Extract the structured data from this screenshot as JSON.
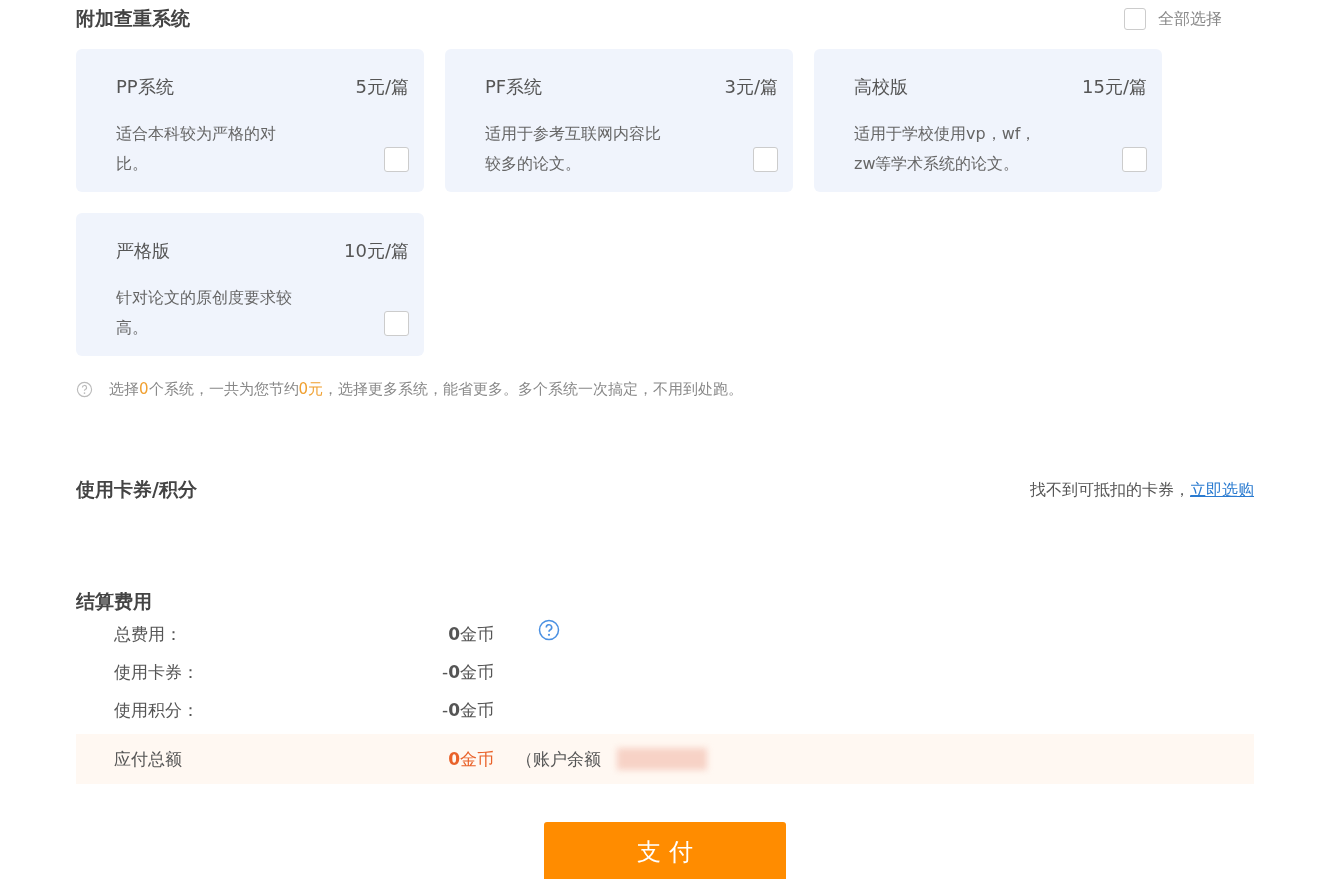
{
  "systems_section": {
    "title": "附加查重系统",
    "select_all": {
      "label": "全部选择",
      "checked": false
    },
    "cards": [
      {
        "name": "PP系统",
        "price": "5元/篇",
        "description": "适合本科较为严格的对比。",
        "checked": false
      },
      {
        "name": "PF系统",
        "price": "3元/篇",
        "description": "适用于参考互联网内容比较多的论文。",
        "checked": false
      },
      {
        "name": "高校版",
        "price": "15元/篇",
        "description": "适用于学校使用vp，wf，zw等学术系统的论文。",
        "checked": false
      },
      {
        "name": "严格版",
        "price": "10元/篇",
        "description": "针对论文的原创度要求较高。",
        "checked": false
      }
    ],
    "hint": [
      {
        "text": "选择",
        "highlight": false
      },
      {
        "text": "0",
        "highlight": true
      },
      {
        "text": "个系统，一共为您节约",
        "highlight": false
      },
      {
        "text": "0元",
        "highlight": true
      },
      {
        "text": "，选择更多系统，能省更多。多个系统一次搞定，不用到处跑。",
        "highlight": false
      }
    ]
  },
  "coupon_section": {
    "title": "使用卡券/积分",
    "note": "找不到可抵扣的卡券，",
    "link": "立即选购"
  },
  "settlement": {
    "title": "结算费用",
    "rows": [
      {
        "label": "总费用：",
        "amount": "**0**金币",
        "help": true
      },
      {
        "label": "使用卡券：",
        "amount": "-**0**金币",
        "help": false
      },
      {
        "label": "使用积分：",
        "amount": "-**0**金币",
        "help": false
      }
    ],
    "total": {
      "label": "应付总额",
      "amount": "**0**金币",
      "balance_label": "（账户余额"
    },
    "pay_button": "支 付"
  }
}
